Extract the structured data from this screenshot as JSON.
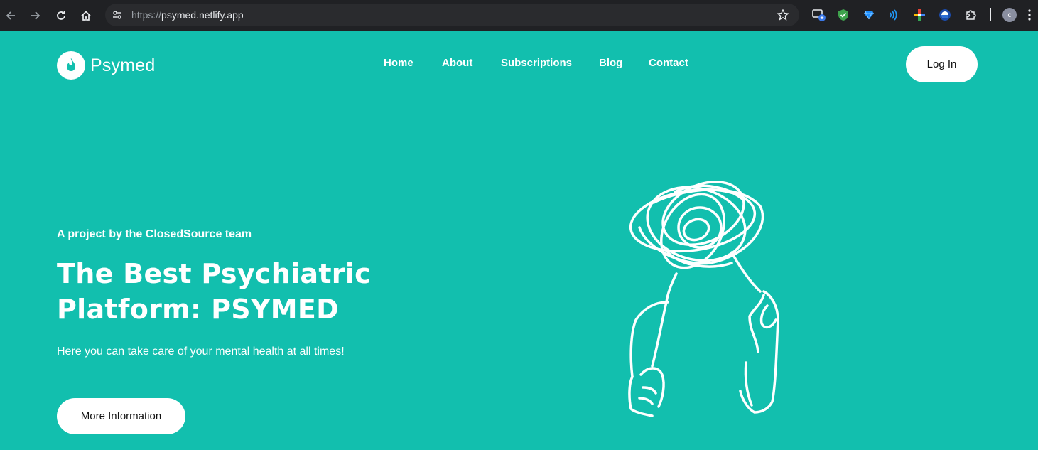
{
  "browser": {
    "url_scheme": "https://",
    "url_host": "psymed.netlify.app",
    "profile_initial": "c"
  },
  "site": {
    "logo_text": "Psymed",
    "nav": [
      {
        "label": "Home"
      },
      {
        "label": "About"
      },
      {
        "label": "Subscriptions"
      },
      {
        "label": "Blog"
      },
      {
        "label": "Contact"
      }
    ],
    "login_label": "Log In"
  },
  "hero": {
    "eyebrow": "A project by the ClosedSource team",
    "headline_line1": "The Best Psychiatric",
    "headline_line2": "Platform: PSYMED",
    "subtext": "Here you can take care of your mental health at all times!",
    "cta_label": "More Information"
  },
  "colors": {
    "accent": "#12bfae",
    "chrome_bg": "#202124",
    "button_bg": "#ffffff"
  },
  "icons": [
    "back-arrow-icon",
    "forward-arrow-icon",
    "reload-icon",
    "home-icon",
    "site-settings-icon",
    "bookmark-star-icon",
    "extensions-puzzle-icon",
    "flame-logo-icon"
  ]
}
